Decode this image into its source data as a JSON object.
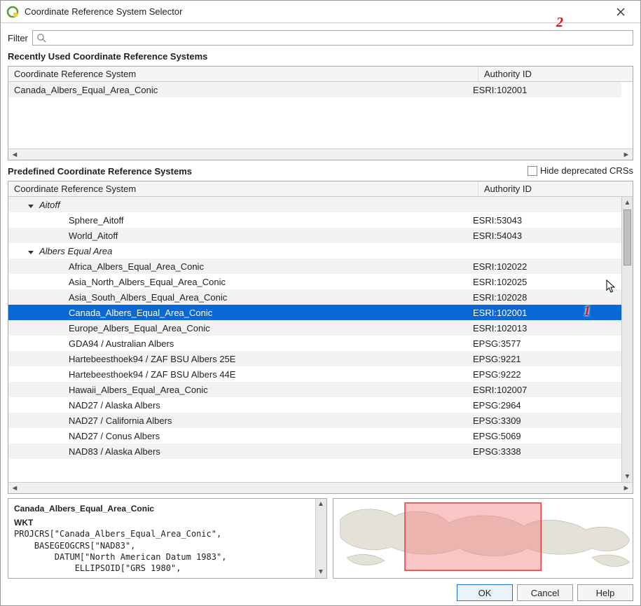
{
  "window": {
    "title": "Coordinate Reference System Selector"
  },
  "filter": {
    "label": "Filter",
    "value": "",
    "placeholder": ""
  },
  "sections": {
    "recent": "Recently Used Coordinate Reference Systems",
    "predef": "Predefined Coordinate Reference Systems",
    "hide_deprecated": "Hide deprecated CRSs"
  },
  "columns": {
    "crs": "Coordinate Reference System",
    "auth": "Authority ID"
  },
  "recent": [
    {
      "crs": "Canada_Albers_Equal_Area_Conic",
      "auth": "ESRI:102001"
    }
  ],
  "predef": [
    {
      "type": "group",
      "label": "Aitoff"
    },
    {
      "type": "item",
      "label": "Sphere_Aitoff",
      "auth": "ESRI:53043"
    },
    {
      "type": "item",
      "label": "World_Aitoff",
      "auth": "ESRI:54043"
    },
    {
      "type": "group",
      "label": "Albers Equal Area"
    },
    {
      "type": "item",
      "label": "Africa_Albers_Equal_Area_Conic",
      "auth": "ESRI:102022"
    },
    {
      "type": "item",
      "label": "Asia_North_Albers_Equal_Area_Conic",
      "auth": "ESRI:102025"
    },
    {
      "type": "item",
      "label": "Asia_South_Albers_Equal_Area_Conic",
      "auth": "ESRI:102028"
    },
    {
      "type": "item",
      "label": "Canada_Albers_Equal_Area_Conic",
      "auth": "ESRI:102001",
      "selected": true
    },
    {
      "type": "item",
      "label": "Europe_Albers_Equal_Area_Conic",
      "auth": "ESRI:102013"
    },
    {
      "type": "item",
      "label": "GDA94 / Australian Albers",
      "auth": "EPSG:3577"
    },
    {
      "type": "item",
      "label": "Hartebeesthoek94 / ZAF BSU Albers 25E",
      "auth": "EPSG:9221"
    },
    {
      "type": "item",
      "label": "Hartebeesthoek94 / ZAF BSU Albers 44E",
      "auth": "EPSG:9222"
    },
    {
      "type": "item",
      "label": "Hawaii_Albers_Equal_Area_Conic",
      "auth": "ESRI:102007"
    },
    {
      "type": "item",
      "label": "NAD27 / Alaska Albers",
      "auth": "EPSG:2964"
    },
    {
      "type": "item",
      "label": "NAD27 / California Albers",
      "auth": "EPSG:3309"
    },
    {
      "type": "item",
      "label": "NAD27 / Conus Albers",
      "auth": "EPSG:5069"
    },
    {
      "type": "item",
      "label": "NAD83 / Alaska Albers",
      "auth": "EPSG:3338"
    }
  ],
  "wkt": {
    "name": "Canada_Albers_Equal_Area_Conic",
    "label": "WKT",
    "lines": [
      "PROJCRS[\"Canada_Albers_Equal_Area_Conic\",",
      "    BASEGEOGCRS[\"NAD83\",",
      "        DATUM[\"North American Datum 1983\",",
      "            ELLIPSOID[\"GRS 1980\","
    ]
  },
  "buttons": {
    "ok": "OK",
    "cancel": "Cancel",
    "help": "Help"
  },
  "callouts": {
    "one": "1",
    "two": "2"
  }
}
